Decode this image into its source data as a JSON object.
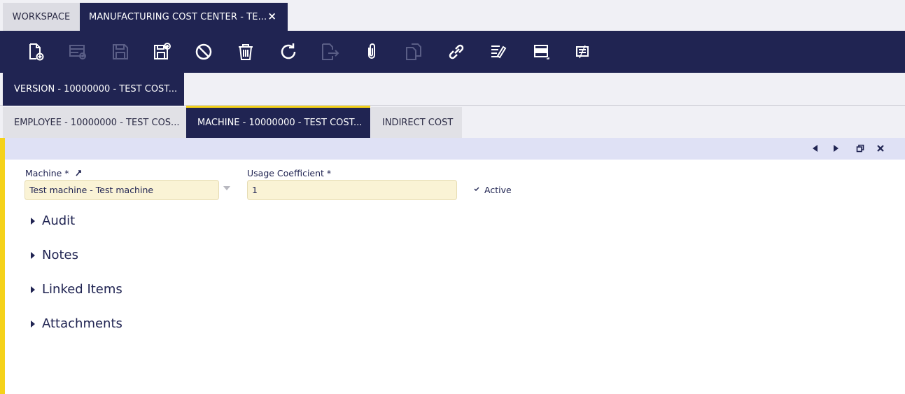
{
  "tabs": {
    "workspace": "WORKSPACE",
    "active": "MANUFACTURING COST CENTER - TE...",
    "close_glyph": "×"
  },
  "toolbar": {
    "icons": [
      "new-document-icon",
      "new-row-icon",
      "save-icon",
      "save-and-new-icon",
      "undo-icon",
      "delete-icon",
      "refresh-icon",
      "export-icon",
      "attachment-icon",
      "copy-icon",
      "link-icon",
      "tools-icon",
      "grid-view-icon",
      "form-view-icon"
    ]
  },
  "level1": {
    "version_tab": "VERSION - 10000000 - TEST COST..."
  },
  "level2": {
    "employee_tab": "EMPLOYEE - 10000000 - TEST COS...",
    "machine_tab": "MACHINE - 10000000 - TEST COST...",
    "indirect_tab": "INDIRECT COST"
  },
  "form": {
    "machine_label": "Machine *",
    "machine_value": "Test machine - Test machine",
    "usage_label": "Usage Coefficient *",
    "usage_value": "1",
    "active_label": "Active",
    "active_checked": true
  },
  "sections": [
    "Audit",
    "Notes",
    "Linked Items",
    "Attachments"
  ],
  "colors": {
    "brand": "#202452",
    "accent": "#f5d21a",
    "field_bg": "#faf3d5"
  }
}
